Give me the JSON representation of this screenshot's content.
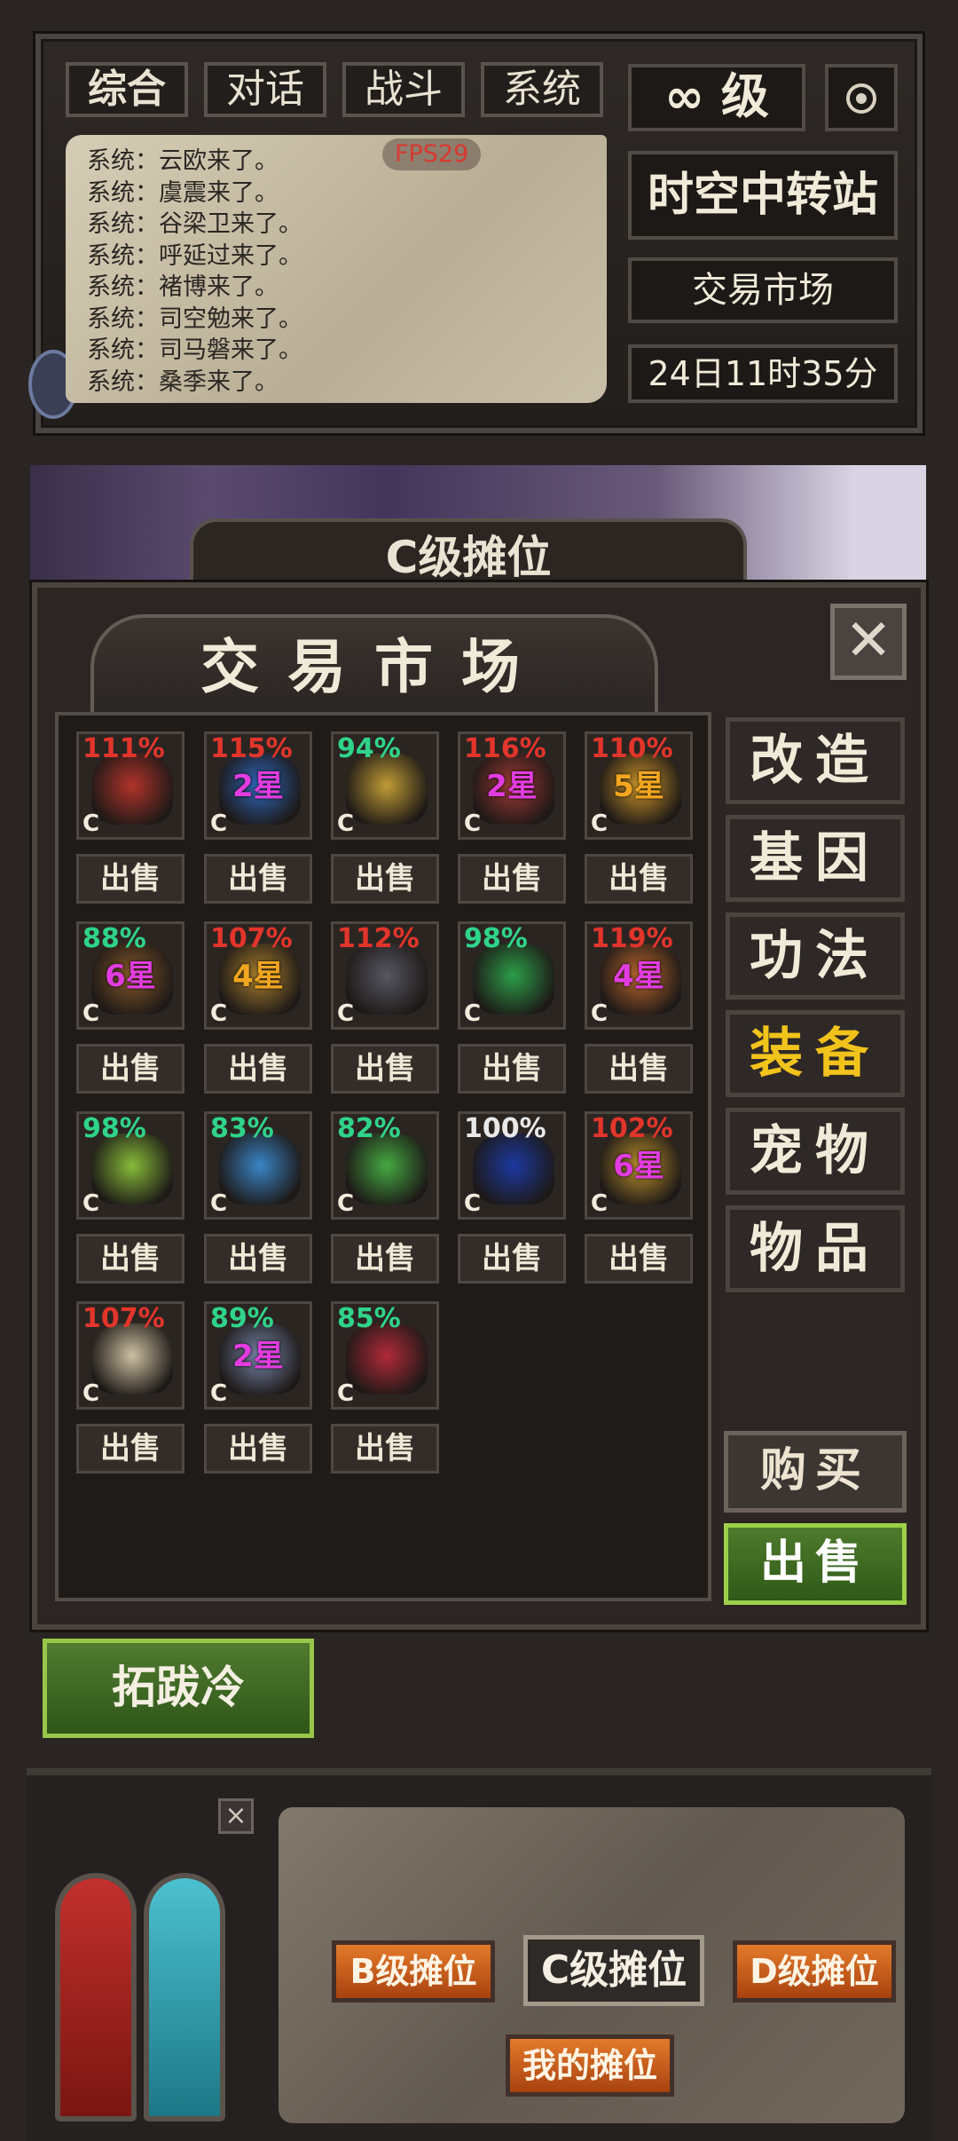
{
  "chat": {
    "tabs": [
      {
        "label": "综合",
        "active": true
      },
      {
        "label": "对话",
        "active": false
      },
      {
        "label": "战斗",
        "active": false
      },
      {
        "label": "系统",
        "active": false
      }
    ],
    "fps": "FPS29",
    "lines": [
      "系统：云欧来了。",
      "系统：虞震来了。",
      "系统：谷梁卫来了。",
      "系统：呼延过来了。",
      "系统：褚博来了。",
      "系统：司空勉来了。",
      "系统：司马磐来了。",
      "系统：桑季来了。"
    ]
  },
  "hud": {
    "level": "∞ 级",
    "settings_icon": "gear-icon",
    "map_name": "时空中转站",
    "area_name": "交易市场",
    "game_time": "24日11时35分"
  },
  "scene": {
    "banner": "C级摊位"
  },
  "market": {
    "title": "交易市场",
    "close_label": "✕",
    "sell_label": "出售",
    "items": [
      {
        "pct": "111%",
        "pct_color": "#e2352b",
        "star": "",
        "grade": "C",
        "art": "#b8342a"
      },
      {
        "pct": "115%",
        "pct_color": "#e2352b",
        "star": "2星",
        "star_color": "#e23ce0",
        "grade": "C",
        "art": "#2f6ac4"
      },
      {
        "pct": "94%",
        "pct_color": "#2fd48a",
        "star": "",
        "grade": "C",
        "art": "#c8a236"
      },
      {
        "pct": "116%",
        "pct_color": "#e2352b",
        "star": "2星",
        "star_color": "#e23ce0",
        "grade": "C",
        "art": "#a53a36"
      },
      {
        "pct": "110%",
        "pct_color": "#e2352b",
        "star": "5星",
        "star_color": "#f2a620",
        "grade": "C",
        "art": "#d49a2a"
      },
      {
        "pct": "88%",
        "pct_color": "#2fd48a",
        "star": "6星",
        "star_color": "#e23ce0",
        "grade": "C",
        "art": "#8a5a2a"
      },
      {
        "pct": "107%",
        "pct_color": "#e2352b",
        "star": "4星",
        "star_color": "#f2a620",
        "grade": "C",
        "art": "#b0842e"
      },
      {
        "pct": "112%",
        "pct_color": "#e2352b",
        "star": "",
        "grade": "C",
        "art": "#5a5a66"
      },
      {
        "pct": "98%",
        "pct_color": "#2fd48a",
        "star": "",
        "grade": "C",
        "art": "#2ca44a"
      },
      {
        "pct": "119%",
        "pct_color": "#e2352b",
        "star": "4星",
        "star_color": "#e23ce0",
        "grade": "C",
        "art": "#c26a2c"
      },
      {
        "pct": "98%",
        "pct_color": "#2fd48a",
        "star": "",
        "grade": "C",
        "art": "#8cc43a"
      },
      {
        "pct": "83%",
        "pct_color": "#2fd48a",
        "star": "",
        "grade": "C",
        "art": "#3a8ad0"
      },
      {
        "pct": "82%",
        "pct_color": "#2fd48a",
        "star": "",
        "grade": "C",
        "art": "#46b044"
      },
      {
        "pct": "100%",
        "pct_color": "#e8e8e8",
        "star": "",
        "grade": "C",
        "art": "#1b3aa8"
      },
      {
        "pct": "102%",
        "pct_color": "#e2352b",
        "star": "6星",
        "star_color": "#e23ce0",
        "grade": "C",
        "art": "#c2952c"
      },
      {
        "pct": "107%",
        "pct_color": "#e2352b",
        "star": "",
        "grade": "C",
        "art": "#d6c8a8"
      },
      {
        "pct": "89%",
        "pct_color": "#2fd48a",
        "star": "2星",
        "star_color": "#e23ce0",
        "grade": "C",
        "art": "#7a8ab0"
      },
      {
        "pct": "85%",
        "pct_color": "#2fd48a",
        "star": "",
        "grade": "C",
        "art": "#b82a3a"
      }
    ],
    "categories": [
      {
        "label": "改造",
        "active": false
      },
      {
        "label": "基因",
        "active": false
      },
      {
        "label": "功法",
        "active": false
      },
      {
        "label": "装备",
        "active": true
      },
      {
        "label": "宠物",
        "active": false
      },
      {
        "label": "物品",
        "active": false
      }
    ],
    "buy_label": "购买",
    "sell_mode_label": "出售"
  },
  "player": {
    "name": "拓跋冷"
  },
  "bottom": {
    "close_label": "×",
    "stall_b": "B级摊位",
    "stall_c": "C级摊位",
    "stall_d": "D级摊位",
    "stall_mine": "我的摊位"
  }
}
